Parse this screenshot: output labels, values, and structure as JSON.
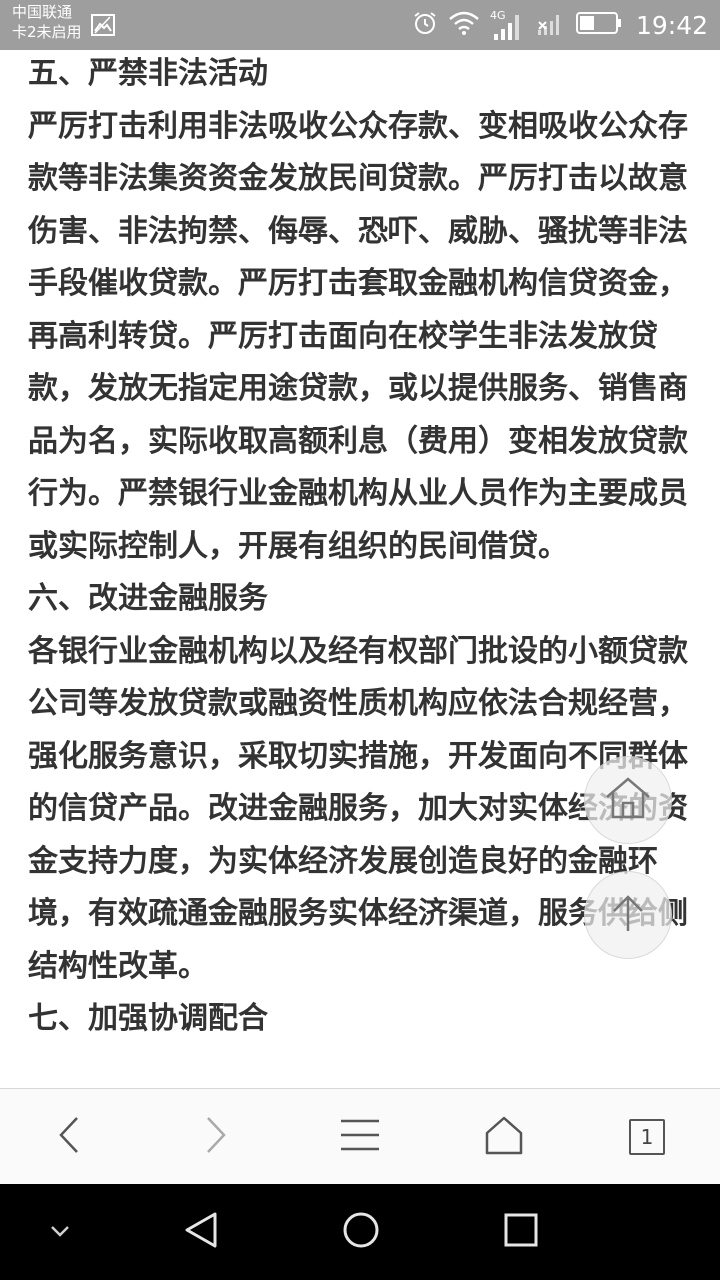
{
  "status_bar": {
    "carrier_line1": "中国联通",
    "carrier_line2": "卡2未启用",
    "network_type": "4G",
    "time": "19:42",
    "icons": [
      "image-icon",
      "alarm-icon",
      "wifi-icon",
      "signal-icon",
      "signal-no-sim-icon",
      "battery-icon"
    ]
  },
  "article": {
    "paragraphs": [
      "五、严禁非法活动",
      "严厉打击利用非法吸收公众存款、变相吸收公众存款等非法集资资金发放民间贷款。严厉打击以故意伤害、非法拘禁、侮辱、恐吓、威胁、骚扰等非法手段催收贷款。严厉打击套取金融机构信贷资金，再高利转贷。严厉打击面向在校学生非法发放贷款，发放无指定用途贷款，或以提供服务、销售商品为名，实际收取高额利息（费用）变相发放贷款行为。严禁银行业金融机构从业人员作为主要成员或实际控制人，开展有组织的民间借贷。",
      "六、改进金融服务",
      "各银行业金融机构以及经有权部门批设的小额贷款公司等发放贷款或融资性质机构应依法合规经营，强化服务意识，采取切实措施，开发面向不同群体的信贷产品。改进金融服务，加大对实体经济的资金支持力度，为实体经济发展创造良好的金融环境，有效疏通金融服务实体经济渠道，服务供给侧结构性改革。",
      "七、加强协调配合"
    ]
  },
  "floating": {
    "home_icon": "home-icon",
    "top_icon": "arrow-up-icon"
  },
  "browser_toolbar": {
    "tab_count": "1",
    "icons": [
      "back-icon",
      "forward-icon",
      "menu-icon",
      "home-icon",
      "tabs-icon"
    ]
  },
  "system_nav": {
    "icons": [
      "hide-keyboard-icon",
      "back-triangle-icon",
      "home-circle-icon",
      "recent-square-icon"
    ]
  }
}
